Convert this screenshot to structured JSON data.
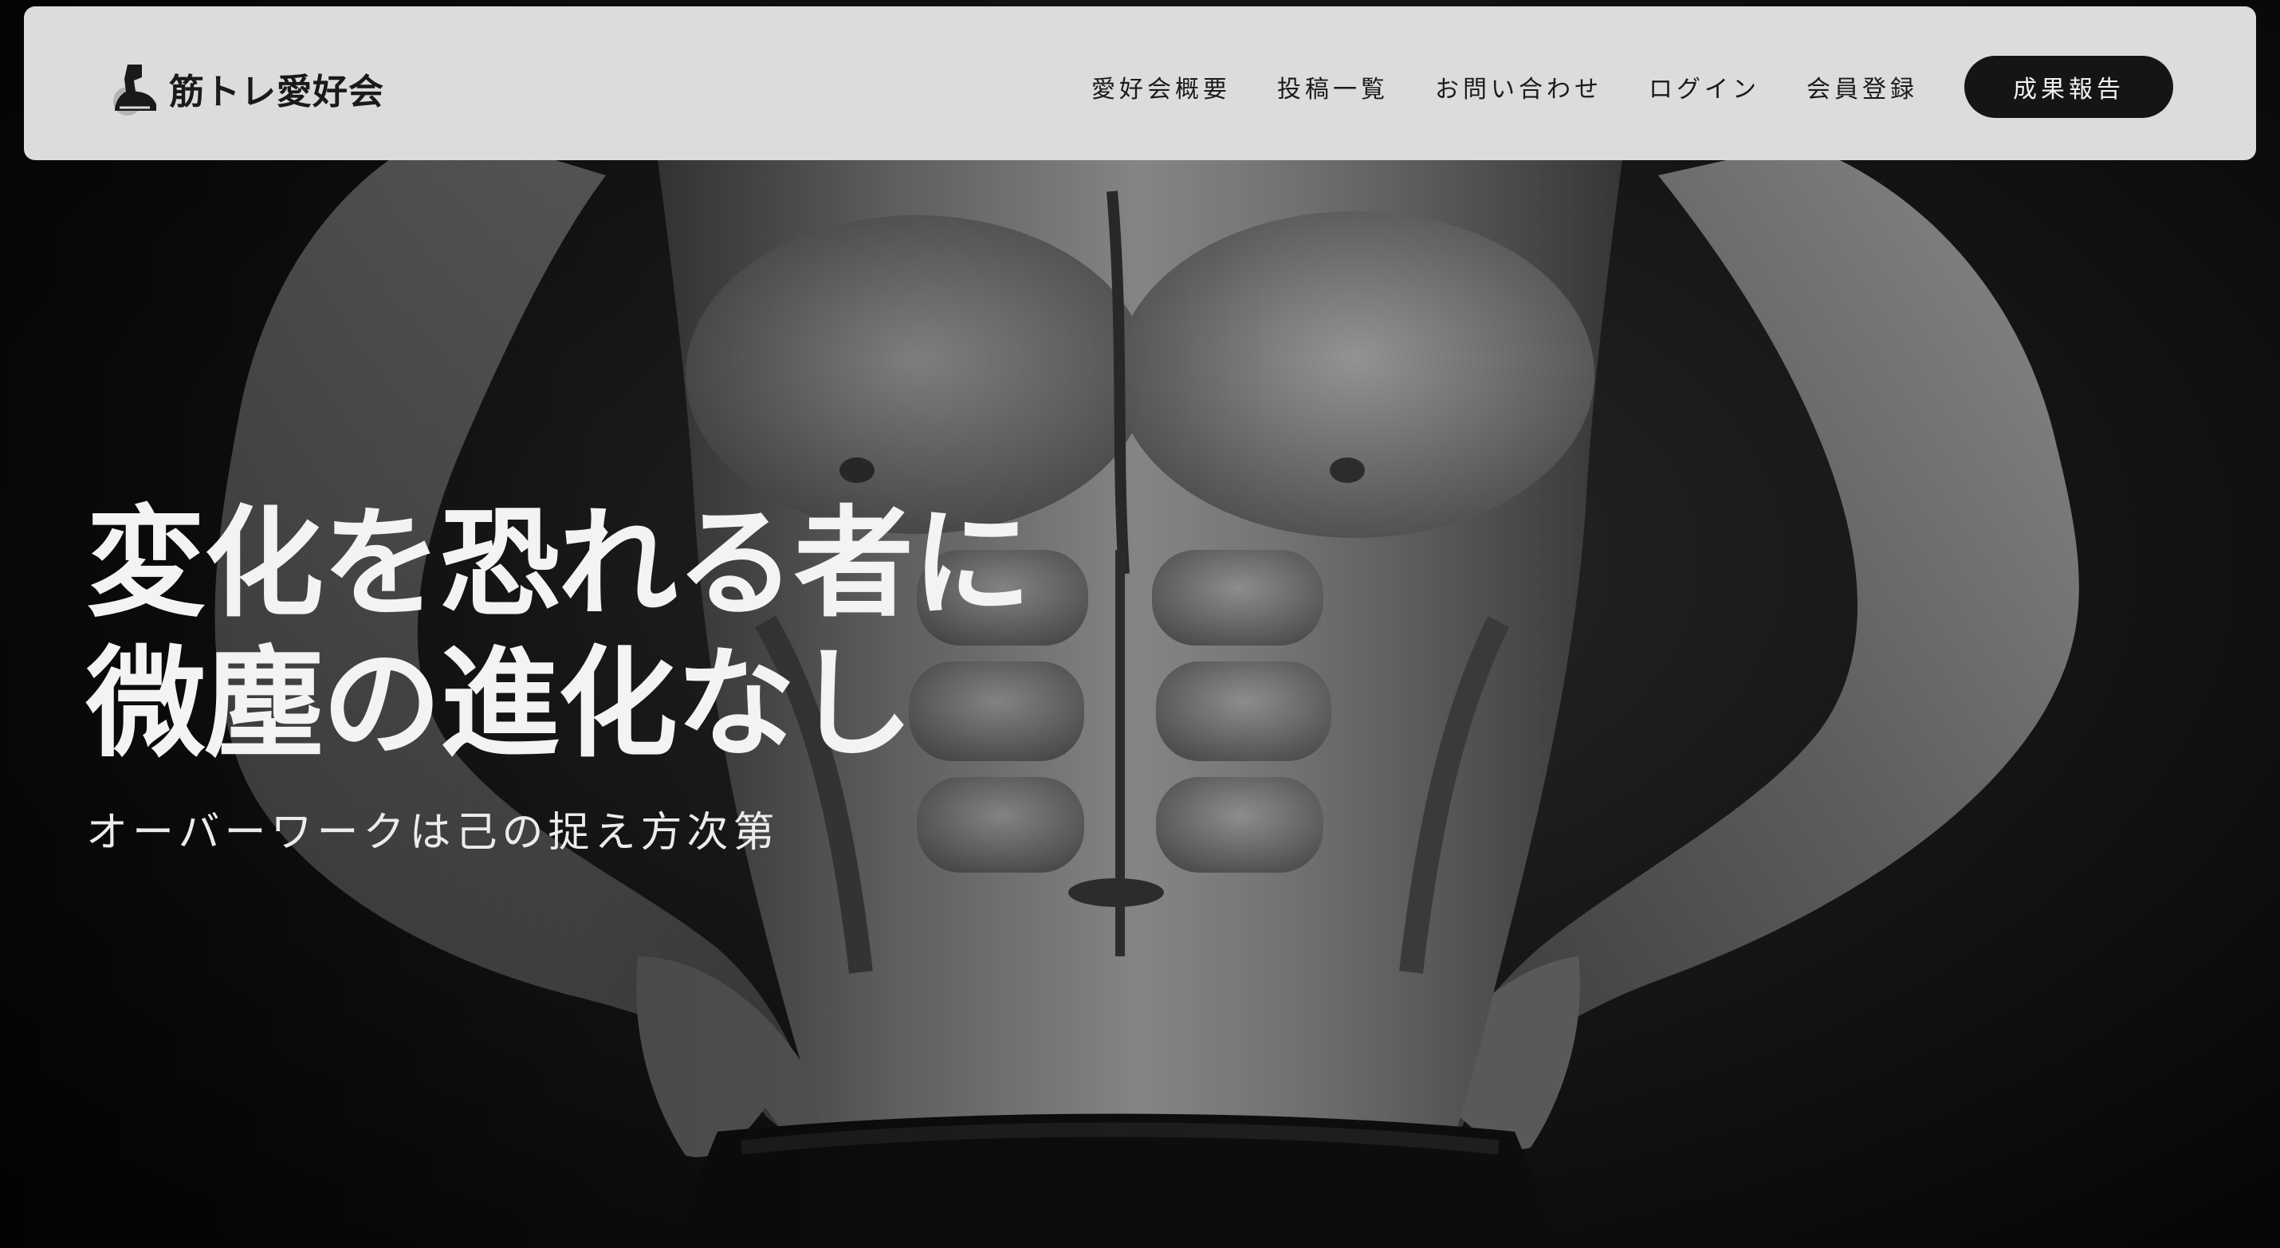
{
  "brand": {
    "name": "筋トレ愛好会",
    "logo_icon": "flexing-arm-icon"
  },
  "nav": {
    "items": [
      {
        "label": "愛好会概要"
      },
      {
        "label": "投稿一覧"
      },
      {
        "label": "お問い合わせ"
      },
      {
        "label": "ログイン"
      },
      {
        "label": "会員登録"
      }
    ],
    "cta_label": "成果報告"
  },
  "hero": {
    "heading_line1": "変化を恐れる者に",
    "heading_line2": "微塵の進化なし",
    "subheading": "オーバーワークは己の捉え方次第",
    "image": "black-and-white-muscular-torso-photo"
  },
  "colors": {
    "header_bg": "#dcdcdc",
    "cta_bg": "#151515",
    "text_light": "#f3f3f3",
    "text_dark": "#1a1a1a",
    "page_bg": "#0b0b0b"
  }
}
